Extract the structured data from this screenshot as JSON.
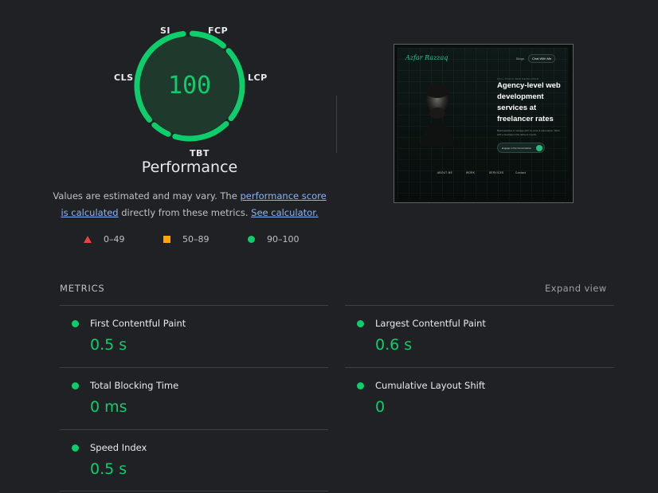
{
  "gauge": {
    "score": "100",
    "title": "Performance",
    "labels": {
      "si": "SI",
      "fcp": "FCP",
      "lcp": "LCP",
      "tbt": "TBT",
      "cls": "CLS"
    }
  },
  "description": {
    "text1": "Values are estimated and may vary. The ",
    "link1": "performance score is calculated",
    "text2": " directly from these metrics. ",
    "link2": "See calculator."
  },
  "legend": {
    "fail": "0–49",
    "average": "50–89",
    "pass": "90–100"
  },
  "colors": {
    "pass": "#0cce6b",
    "average": "#ffa400",
    "fail": "#e8453c",
    "link": "#8ab4f8",
    "background": "#202124"
  },
  "thumbnail": {
    "logo": "Azfar Razzaq",
    "nav_blogs": "Blogs",
    "nav_chat": "Chat With Me",
    "tag": "FULL-STACK WEB DEVELOPER",
    "headline": "Agency-level web development services at freelancer rates",
    "subtext": "Build websites & manage with no-code & automation. Work with a developer who delivers results.",
    "cta": "Engage in the Conversation",
    "footer": [
      "ABOUT ME",
      "WORK",
      "SERVICES",
      "Contact"
    ]
  },
  "metrics": {
    "title": "METRICS",
    "expand": "Expand view",
    "fcp": {
      "label": "First Contentful Paint",
      "value": "0.5 s"
    },
    "lcp": {
      "label": "Largest Contentful Paint",
      "value": "0.6 s"
    },
    "tbt": {
      "label": "Total Blocking Time",
      "value": "0 ms"
    },
    "cls": {
      "label": "Cumulative Layout Shift",
      "value": "0"
    },
    "si": {
      "label": "Speed Index",
      "value": "0.5 s"
    }
  }
}
